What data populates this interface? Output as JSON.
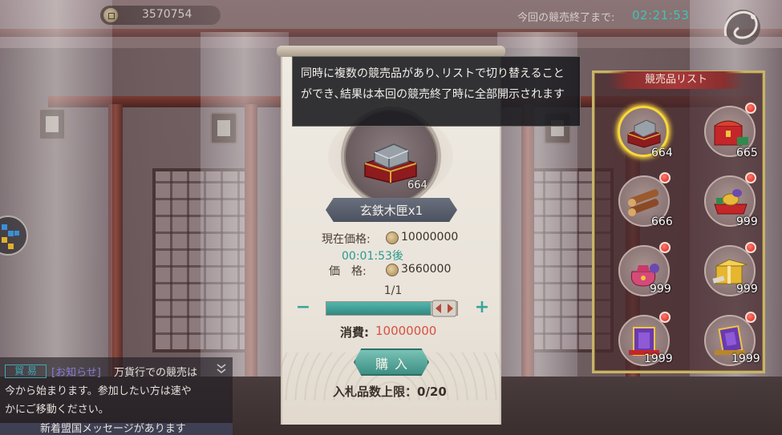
{
  "hud": {
    "currency_value": "3570754",
    "auction_end_label": "今回の競売終了まで:",
    "auction_end_time": "02:21:53"
  },
  "tooltip": {
    "text": "同時に複数の競売品があり､リストで切り替えることができ､結果は本回の競売終了時に全部開示されます"
  },
  "auction": {
    "item_quantity": "664",
    "item_name": "玄鉄木匣x1",
    "current_price_label": "現在価格:",
    "current_price_value": "10000000",
    "countdown": "00:01:53後",
    "price_label": "価　格:",
    "price_value": "3660000",
    "page_indicator": "1/1",
    "minus_label": "−",
    "plus_label": "+",
    "slider_level": 0.8,
    "cost_label": "消費:",
    "cost_value": "10000000",
    "buy_label": "購入",
    "bid_limit": "入札品数上限：0/20"
  },
  "item_list": {
    "title": "競売品リスト",
    "items": [
      {
        "icon": "iron-box-icon",
        "qty": "664",
        "selected": true,
        "badge": false
      },
      {
        "icon": "treasure-chest-icon",
        "qty": "665",
        "selected": false,
        "badge": true
      },
      {
        "icon": "wood-logs-icon",
        "qty": "666",
        "selected": false,
        "badge": true
      },
      {
        "icon": "gold-ingot-cart-icon",
        "qty": "999",
        "selected": false,
        "badge": true
      },
      {
        "icon": "gift-pouch-icon",
        "qty": "999",
        "selected": false,
        "badge": true
      },
      {
        "icon": "gold-box-icon",
        "qty": "999",
        "selected": false,
        "badge": true
      },
      {
        "icon": "purple-book-icon",
        "qty": "1999",
        "selected": false,
        "badge": true
      },
      {
        "icon": "purple-book-stack-icon",
        "qty": "1999",
        "selected": false,
        "badge": true
      }
    ]
  },
  "chat": {
    "tag": "貿 易",
    "channel": "[お知らせ]",
    "line1": "万貨行での競売は",
    "line2": "今から始まります。参加したい方は速や",
    "line3": "かにご移動ください。",
    "alliance_message": "新着盟国メッセージがあります"
  },
  "colors": {
    "accent_teal": "#3fc4b4",
    "cost_red": "#d8503f",
    "panel_gold": "#c9b36a",
    "badge_red": "#d8221a"
  }
}
